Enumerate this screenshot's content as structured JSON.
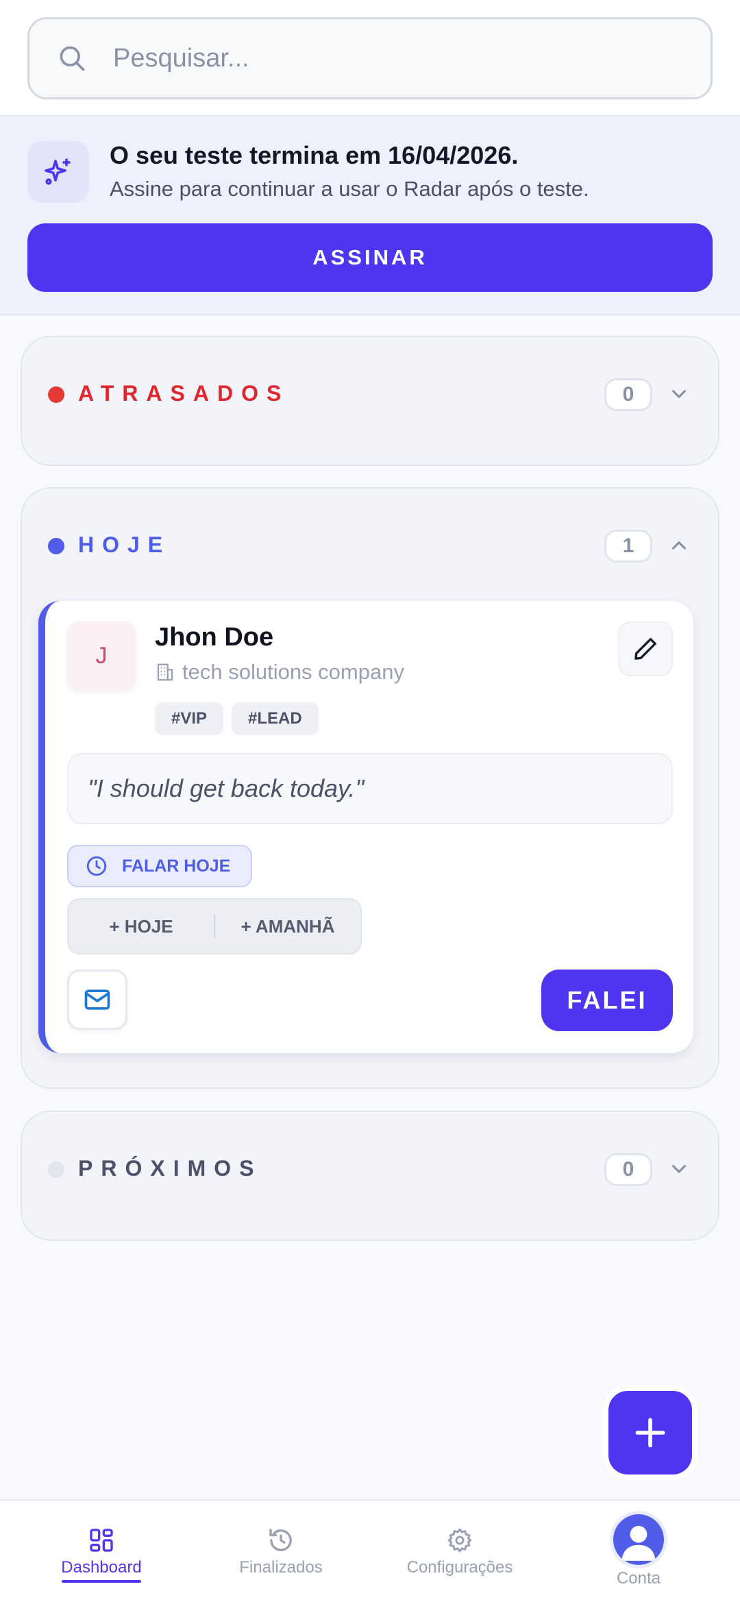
{
  "search": {
    "placeholder": "Pesquisar..."
  },
  "trial": {
    "title": "O seu teste termina em 16/04/2026.",
    "subtitle": "Assine para continuar a usar o Radar após o teste.",
    "button": "ASSINAR"
  },
  "sections": {
    "overdue": {
      "title": "ATRASADOS",
      "count": "0",
      "color": "#e53935"
    },
    "today": {
      "title": "HOJE",
      "count": "1",
      "color": "#4f5de8"
    },
    "upcoming": {
      "title": "PRÓXIMOS",
      "count": "0",
      "color": "#e3e5ec"
    }
  },
  "contact": {
    "initial": "J",
    "name": "Jhon Doe",
    "company": "tech solutions company",
    "tags": [
      "#VIP",
      "#LEAD"
    ],
    "note": "\"I should get back today.\"",
    "badge": "FALAR HOJE",
    "snooze_today": "+ HOJE",
    "snooze_tomorrow": "+ AMANHÃ",
    "done_button": "FALEI"
  },
  "nav": {
    "items": [
      {
        "label": "Dashboard",
        "icon": "grid-icon"
      },
      {
        "label": "Finalizados",
        "icon": "history-icon"
      },
      {
        "label": "Configurações",
        "icon": "gear-icon"
      },
      {
        "label": "Conta",
        "icon": "avatar-icon"
      }
    ],
    "active": "Dashboard"
  },
  "colors": {
    "accent": "#4f35f0",
    "today": "#4f5de8",
    "overdue": "#e53935"
  }
}
